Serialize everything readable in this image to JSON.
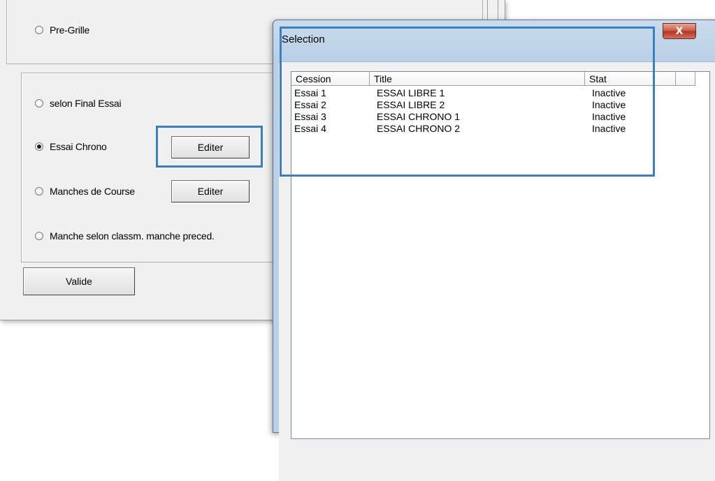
{
  "main_window": {
    "radio_pregrille": "Pre-Grille",
    "radio_final_essai": "selon Final Essai",
    "radio_essai_chrono": "Essai Chrono",
    "radio_manches": "Manches de Course",
    "radio_manche_classm": "Manche selon classm. manche preced.",
    "edit_button_1": "Editer",
    "edit_button_2": "Editer",
    "valide_button": "Valide"
  },
  "dialog": {
    "title": "Selection",
    "close_glyph": "X",
    "columns": [
      "Cession",
      "Title",
      "Stat"
    ],
    "rows": [
      {
        "cession": "Essai  1",
        "title": "ESSAI LIBRE 1",
        "stat": "Inactive"
      },
      {
        "cession": "Essai  2",
        "title": "ESSAI LIBRE 2",
        "stat": "Inactive"
      },
      {
        "cession": "Essai  3",
        "title": "ESSAI CHRONO 1",
        "stat": "Inactive"
      },
      {
        "cession": "Essai  4",
        "title": "ESSAI CHRONO 2",
        "stat": "Inactive"
      }
    ]
  },
  "colors": {
    "highlight": "#3a7fc1",
    "window_bg": "#f0f0f0"
  }
}
